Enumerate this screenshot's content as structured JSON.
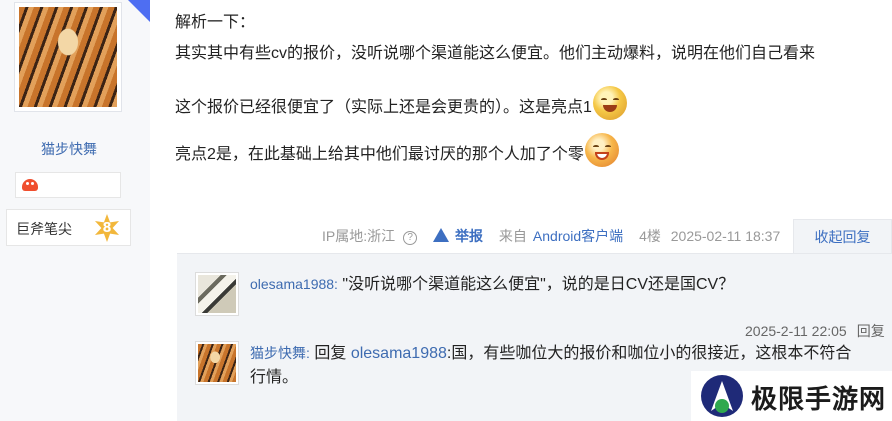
{
  "author": {
    "name": "猫步快舞",
    "level_title": "巨斧笔尖",
    "level_number": "8"
  },
  "post": {
    "lines": [
      "解析一下：",
      "其实其中有些cv的报价，没听说哪个渠道能这么便宜。他们主动爆料，说明在他们自己看来",
      "这个报价已经很便宜了（实际上还是会更贵的）。这是亮点1",
      "亮点2是，在此基础上给其中他们最讨厌的那个人加了个零"
    ],
    "meta": {
      "ip_location": "IP属地:浙江",
      "report_label": "举报",
      "source_prefix": "来自",
      "source_client": "Android客户端",
      "floor": "4楼",
      "timestamp": "2025-02-11 18:37"
    },
    "collapse_label": "收起回复"
  },
  "replies": [
    {
      "user": "olesama1988:",
      "text": "\"没听说哪个渠道能这么便宜\"，说的是日CV还是国CV？",
      "time": "2025-2-11 22:05",
      "reply_label": "回复"
    },
    {
      "user": "猫步快舞:",
      "prefix": "回复",
      "target": "olesama1988",
      "text": ":国，有些咖位大的报价和咖位小的很接近，这根本不符合行情。"
    }
  ],
  "watermark": {
    "text": "极限手游网"
  },
  "colors": {
    "link_blue": "#3d6fc1",
    "user_blue": "#3e6bb0",
    "reply_bg": "#f2f4f7"
  }
}
